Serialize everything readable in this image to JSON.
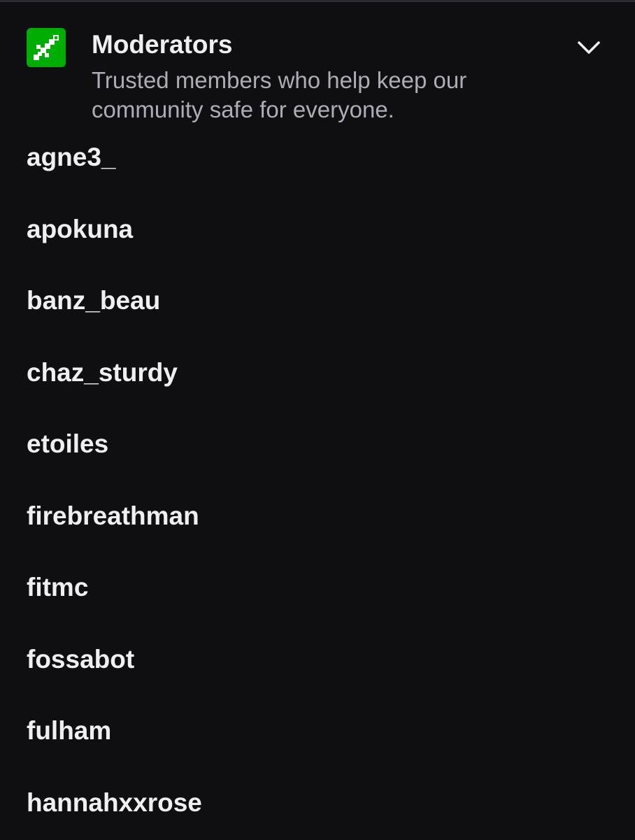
{
  "section": {
    "title": "Moderators",
    "description": "Trusted members who help keep our community safe for everyone.",
    "badge_icon": "sword-icon",
    "badge_color": "#00ad03",
    "collapse_icon": "chevron-down-icon"
  },
  "moderators": [
    {
      "name": "agne3_"
    },
    {
      "name": "apokuna"
    },
    {
      "name": "banz_beau"
    },
    {
      "name": "chaz_sturdy"
    },
    {
      "name": "etoiles"
    },
    {
      "name": "firebreathman"
    },
    {
      "name": "fitmc"
    },
    {
      "name": "fossabot"
    },
    {
      "name": "fulham"
    },
    {
      "name": "hannahxxrose"
    }
  ]
}
